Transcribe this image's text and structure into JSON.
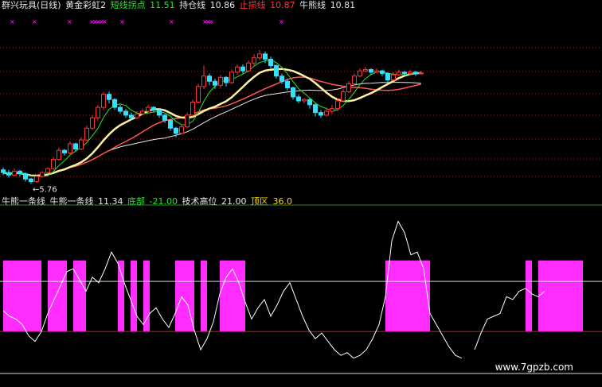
{
  "top_legend": {
    "title": "群兴玩具(日线)",
    "indicator": "黄金彩虹2",
    "short_label": "短线拐点",
    "short_value": "11.51",
    "hold_label": "持仓线",
    "hold_value": "10.86",
    "stop_label": "止损线",
    "stop_value": "10.87",
    "bear_label": "牛熊线",
    "bear_value": "10.81"
  },
  "bottom_legend": {
    "title": "牛熊一条线",
    "line_label": "牛熊一条线",
    "line_value": "11.34",
    "bottom_label": "底部",
    "bottom_value": "-21.00",
    "high_label": "技术高位",
    "high_value": "21.00",
    "top_label": "顶区",
    "top_value": "36.0"
  },
  "low_annotation": "5.76",
  "watermark": "www.7gpzb.com",
  "colors": {
    "up": "#ff3333",
    "down": "#35e0ff",
    "ma_short": "#27e427",
    "ma_mid": "#ff5555",
    "ma_yellow": "#fff1a0",
    "ma_white": "#e8e8e8",
    "zone": "#ff2cff",
    "osc_line": "#ffffff"
  },
  "chart_data": [
    {
      "type": "candlestick",
      "title": "群兴玩具(日线)",
      "series": [
        {
          "name": "短线拐点",
          "value": 11.51
        },
        {
          "name": "持仓线",
          "value": 10.86
        },
        {
          "name": "止损线",
          "value": 10.87
        },
        {
          "name": "牛熊线",
          "value": 10.81
        }
      ],
      "low_marker": 5.76,
      "candles": [
        [
          6.3,
          6.2,
          6.4,
          6.1
        ],
        [
          6.2,
          6.1,
          6.3,
          6.0
        ],
        [
          6.1,
          6.25,
          6.35,
          6.05
        ],
        [
          6.25,
          6.15,
          6.3,
          6.05
        ],
        [
          6.15,
          5.95,
          6.2,
          5.85
        ],
        [
          5.95,
          5.85,
          6.0,
          5.76
        ],
        [
          5.85,
          6.05,
          6.1,
          5.8
        ],
        [
          6.05,
          6.2,
          6.25,
          6.0
        ],
        [
          6.2,
          6.35,
          6.4,
          6.15
        ],
        [
          6.35,
          6.7,
          6.8,
          6.3
        ],
        [
          6.7,
          7.05,
          7.15,
          6.65
        ],
        [
          7.05,
          6.95,
          7.1,
          6.85
        ],
        [
          6.95,
          7.3,
          7.4,
          6.9
        ],
        [
          7.3,
          7.1,
          7.35,
          7.0
        ],
        [
          7.1,
          7.45,
          7.55,
          7.05
        ],
        [
          7.45,
          7.9,
          8.0,
          7.4
        ],
        [
          7.9,
          8.3,
          8.4,
          7.85
        ],
        [
          8.3,
          8.7,
          8.8,
          8.2
        ],
        [
          8.7,
          9.2,
          9.3,
          8.6
        ],
        [
          9.2,
          9.0,
          9.3,
          8.85
        ],
        [
          9.0,
          8.7,
          9.05,
          8.6
        ],
        [
          8.7,
          8.55,
          8.8,
          8.45
        ],
        [
          8.55,
          8.4,
          8.65,
          8.3
        ],
        [
          8.4,
          8.3,
          8.5,
          8.2
        ],
        [
          8.3,
          8.45,
          8.55,
          8.25
        ],
        [
          8.45,
          8.55,
          8.65,
          8.4
        ],
        [
          8.55,
          8.7,
          8.8,
          8.5
        ],
        [
          8.7,
          8.6,
          8.75,
          8.5
        ],
        [
          8.6,
          8.4,
          8.65,
          8.3
        ],
        [
          8.4,
          8.2,
          8.45,
          8.1
        ],
        [
          8.2,
          7.9,
          8.25,
          7.8
        ],
        [
          7.9,
          7.7,
          7.95,
          7.55
        ],
        [
          7.7,
          7.95,
          8.05,
          7.65
        ],
        [
          7.95,
          8.4,
          8.5,
          7.9
        ],
        [
          8.4,
          8.9,
          9.0,
          8.35
        ],
        [
          8.9,
          9.5,
          9.6,
          8.85
        ],
        [
          9.5,
          9.9,
          10.3,
          9.4
        ],
        [
          9.9,
          9.7,
          10.0,
          9.55
        ],
        [
          9.7,
          9.55,
          9.8,
          9.4
        ],
        [
          9.55,
          9.85,
          9.95,
          9.45
        ],
        [
          9.85,
          9.65,
          9.9,
          9.5
        ],
        [
          9.65,
          10.05,
          10.15,
          9.6
        ],
        [
          10.05,
          10.25,
          10.35,
          9.95
        ],
        [
          10.25,
          10.1,
          10.35,
          10.0
        ],
        [
          10.1,
          10.4,
          10.5,
          10.05
        ],
        [
          10.4,
          10.6,
          10.75,
          10.3
        ],
        [
          10.6,
          10.75,
          10.9,
          10.5
        ],
        [
          10.75,
          10.55,
          10.85,
          10.4
        ],
        [
          10.55,
          10.3,
          10.65,
          10.2
        ],
        [
          10.3,
          9.9,
          10.35,
          9.8
        ],
        [
          9.9,
          9.7,
          10.0,
          9.6
        ],
        [
          9.7,
          9.45,
          9.8,
          9.35
        ],
        [
          9.45,
          9.1,
          9.5,
          9.0
        ],
        [
          9.1,
          8.95,
          9.2,
          8.85
        ],
        [
          8.95,
          9.0,
          9.05,
          8.85
        ],
        [
          9.0,
          8.8,
          9.05,
          8.65
        ],
        [
          8.8,
          8.5,
          8.85,
          8.35
        ],
        [
          8.5,
          8.4,
          8.6,
          8.3
        ],
        [
          8.4,
          8.55,
          8.7,
          8.35
        ],
        [
          8.55,
          8.65,
          8.8,
          8.45
        ],
        [
          8.65,
          8.95,
          9.05,
          8.55
        ],
        [
          8.95,
          9.3,
          9.4,
          8.9
        ],
        [
          9.3,
          9.6,
          9.7,
          9.25
        ],
        [
          9.6,
          9.9,
          10.0,
          9.55
        ],
        [
          9.9,
          10.1,
          10.2,
          9.85
        ],
        [
          10.1,
          10.15,
          10.25,
          10.05
        ],
        [
          10.15,
          10.05,
          10.2,
          9.95
        ],
        [
          10.05,
          10.1,
          10.2,
          10.0
        ],
        [
          10.1,
          10.0,
          10.15,
          9.9
        ],
        [
          10.0,
          9.75,
          10.05,
          9.65
        ],
        [
          9.75,
          9.95,
          10.05,
          9.7
        ],
        [
          9.95,
          10.05,
          10.15,
          9.9
        ],
        [
          10.05,
          10.0,
          10.1,
          9.9
        ],
        [
          10.0,
          10.05,
          10.15,
          9.95
        ],
        [
          10.05,
          10.0,
          10.1,
          9.9
        ],
        [
          10.0,
          10.02,
          10.1,
          9.95
        ]
      ]
    },
    {
      "type": "line",
      "title": "牛熊一条线",
      "series": [
        {
          "name": "牛熊一条线",
          "value": 11.34
        },
        {
          "name": "底部",
          "value": -21.0
        },
        {
          "name": "技术高位",
          "value": 21.0
        },
        {
          "name": "顶区",
          "value": 36.0
        }
      ],
      "x": [
        0,
        1,
        2,
        3,
        4,
        5,
        6,
        7,
        8,
        9,
        10,
        11,
        12,
        13,
        14,
        15,
        16,
        17,
        18,
        19,
        20,
        21,
        22,
        23,
        24,
        25,
        26,
        27,
        28,
        29,
        30,
        31,
        32,
        33,
        34,
        35,
        36,
        37,
        38,
        39,
        40,
        41,
        42,
        43,
        44,
        45,
        46,
        47,
        48,
        49,
        50,
        51,
        52,
        53,
        54,
        55,
        56,
        57,
        58,
        59,
        60,
        61,
        62,
        63,
        64,
        65,
        66,
        67,
        68,
        69,
        70,
        71,
        72,
        73,
        74,
        75
      ],
      "values": [
        0,
        -4,
        -6,
        -10,
        -18,
        -22,
        -15,
        -2,
        8,
        18,
        28,
        30,
        22,
        14,
        24,
        20,
        30,
        42,
        34,
        20,
        8,
        -4,
        -10,
        -2,
        2,
        -6,
        -12,
        -2,
        10,
        4,
        -14,
        -28,
        -20,
        -8,
        12,
        24,
        30,
        20,
        6,
        -6,
        2,
        8,
        -4,
        4,
        14,
        20,
        8,
        -4,
        -14,
        -20,
        -16,
        -22,
        -28,
        -32,
        -30,
        -34,
        -32,
        -28,
        -20,
        -10,
        10,
        50,
        64,
        56,
        40,
        42,
        30,
        -2,
        -10,
        -18,
        -26,
        -32,
        -34,
        null,
        -28,
        -16,
        -6,
        -4,
        -2,
        10,
        8,
        14,
        16,
        12,
        10,
        14
      ],
      "zones": [
        [
          0,
          6
        ],
        [
          7,
          10
        ],
        [
          11,
          13
        ],
        [
          18,
          19
        ],
        [
          20,
          21
        ],
        [
          22,
          23
        ],
        [
          27,
          30
        ],
        [
          31,
          32
        ],
        [
          34,
          38
        ],
        [
          60,
          67
        ],
        [
          82,
          83
        ],
        [
          84,
          91
        ]
      ],
      "levels": {
        "top": 36.0,
        "high": 21.0,
        "bottom": -21.0
      }
    }
  ]
}
